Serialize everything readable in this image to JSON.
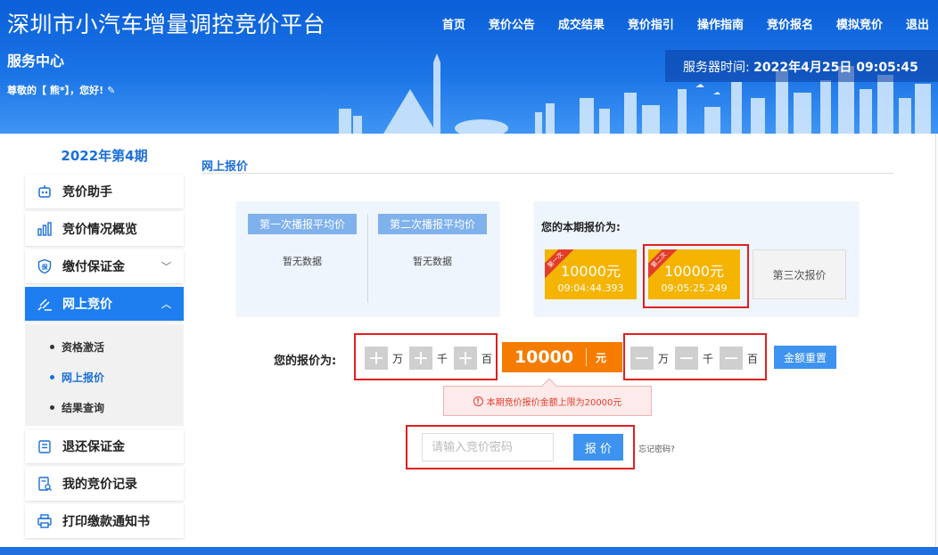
{
  "header": {
    "site_title": "深圳市小汽车增量调控竞价平台",
    "service_center": "服务中心",
    "greeting": "尊敬的【 熊*】，您好!",
    "nav": [
      "首页",
      "竞价公告",
      "成交结果",
      "竞价指引",
      "操作指南",
      "竞价报名",
      "模拟竞价",
      "退出"
    ],
    "server_time_label": "服务器时间:",
    "server_time_value": "2022年4月25日 09:05:45"
  },
  "sidebar": {
    "period": "2022年第4期",
    "items": [
      {
        "label": "竞价助手",
        "icon": "robot-icon"
      },
      {
        "label": "竞价情况概览",
        "icon": "bar-chart-icon"
      },
      {
        "label": "缴付保证金",
        "icon": "shield-deposit-icon"
      },
      {
        "label": "网上竞价",
        "icon": "gavel-icon"
      },
      {
        "label": "退还保证金",
        "icon": "refund-icon"
      },
      {
        "label": "我的竞价记录",
        "icon": "record-icon"
      },
      {
        "label": "打印缴款通知书",
        "icon": "printer-icon"
      }
    ],
    "submenu": [
      "资格激活",
      "网上报价",
      "结果查询"
    ]
  },
  "main": {
    "section_title": "网上报价",
    "avg1_label": "第一次播报平均价",
    "avg1_value": "暂无数据",
    "avg2_label": "第二次播报平均价",
    "avg2_value": "暂无数据",
    "my_title": "您的本期报价为:",
    "bids": [
      {
        "ribbon": "第一次",
        "amount": "10000元",
        "time": "09:04:44.393"
      },
      {
        "ribbon": "第二次",
        "amount": "10000元",
        "time": "09:05:25.249"
      }
    ],
    "third_label": "第三次报价",
    "bid_label": "您的报价为:",
    "plus_units": [
      "万",
      "千",
      "百"
    ],
    "price_value": "10000",
    "price_unit": "元",
    "minus_units": [
      "万",
      "千",
      "百"
    ],
    "reset_label": "金额重置",
    "warning": "本期竞价报价金额上限为20000元",
    "password_placeholder": "请输入竞价密码",
    "submit_label": "报 价",
    "forgot_label": "忘记密码?"
  },
  "colors": {
    "primary": "#1e7ef0",
    "header": "#0b5fd8",
    "price": "#f57c00",
    "bid_card": "#f4b400",
    "highlight": "#e02020"
  }
}
